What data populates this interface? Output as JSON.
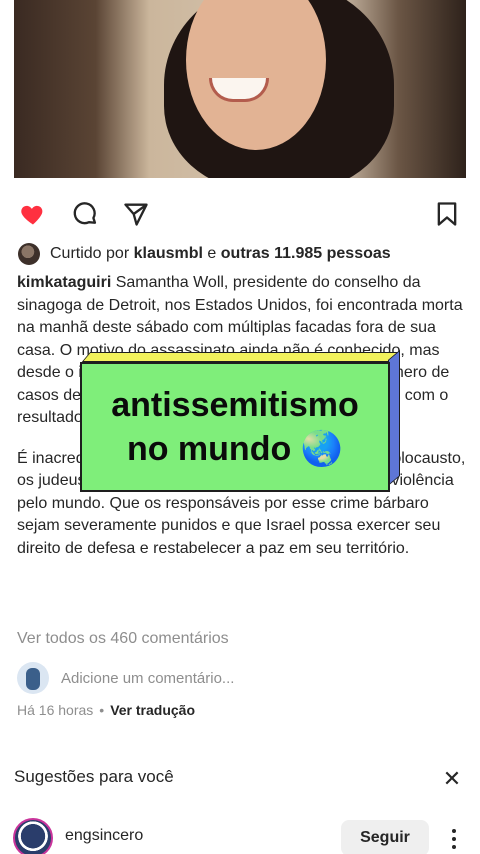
{
  "post": {
    "likes": {
      "prefix": "Curtido por",
      "user": "klausmbl",
      "connector": "e",
      "others": "outras 11.985 pessoas"
    },
    "caption": {
      "username": "kimkataguiri",
      "paragraph1": "Samantha Woll, presidente do conselho da sinagoga de Detroit, nos Estados Unidos, foi encontrada morta na manhã deste sábado com múltiplas facadas fora de sua casa. O motivo do assassinato ainda não é conhecido, mas desde o início da guerra entre o Hamas e Israel o número de casos de antissemitismo aumentou em todo o mundo, com o resultado do assassinato.",
      "paragraph2": "É inacreditável e triste que poucas décadas após o holocausto, os judeus estejam sofrendo novamente esse tipo de violência pelo mundo. Que os responsáveis por esse crime bárbaro sejam severamente punidos e que Israel possa exercer seu direito de defesa e restabelecer a paz em seu território."
    },
    "view_comments": "Ver todos os 460 comentários",
    "add_comment_placeholder": "Adicione um comentário...",
    "time_ago": "Há 16 horas",
    "separator": "•",
    "translate": "Ver tradução"
  },
  "overlay": {
    "line1": "antissemitismo",
    "line2": "no mundo 🌏"
  },
  "suggestions": {
    "title": "Sugestões para você",
    "close": "✕",
    "items": [
      {
        "username": "engsincero",
        "follow_label": "Seguir"
      }
    ]
  },
  "icons": {
    "like": "heart-filled-icon",
    "comment": "comment-bubble-icon",
    "share": "paper-plane-icon",
    "save": "bookmark-icon"
  },
  "colors": {
    "like_red": "#ff3040",
    "overlay_green": "#7fee7a",
    "overlay_side": "#5e76d6",
    "overlay_top": "#f2f25c"
  }
}
